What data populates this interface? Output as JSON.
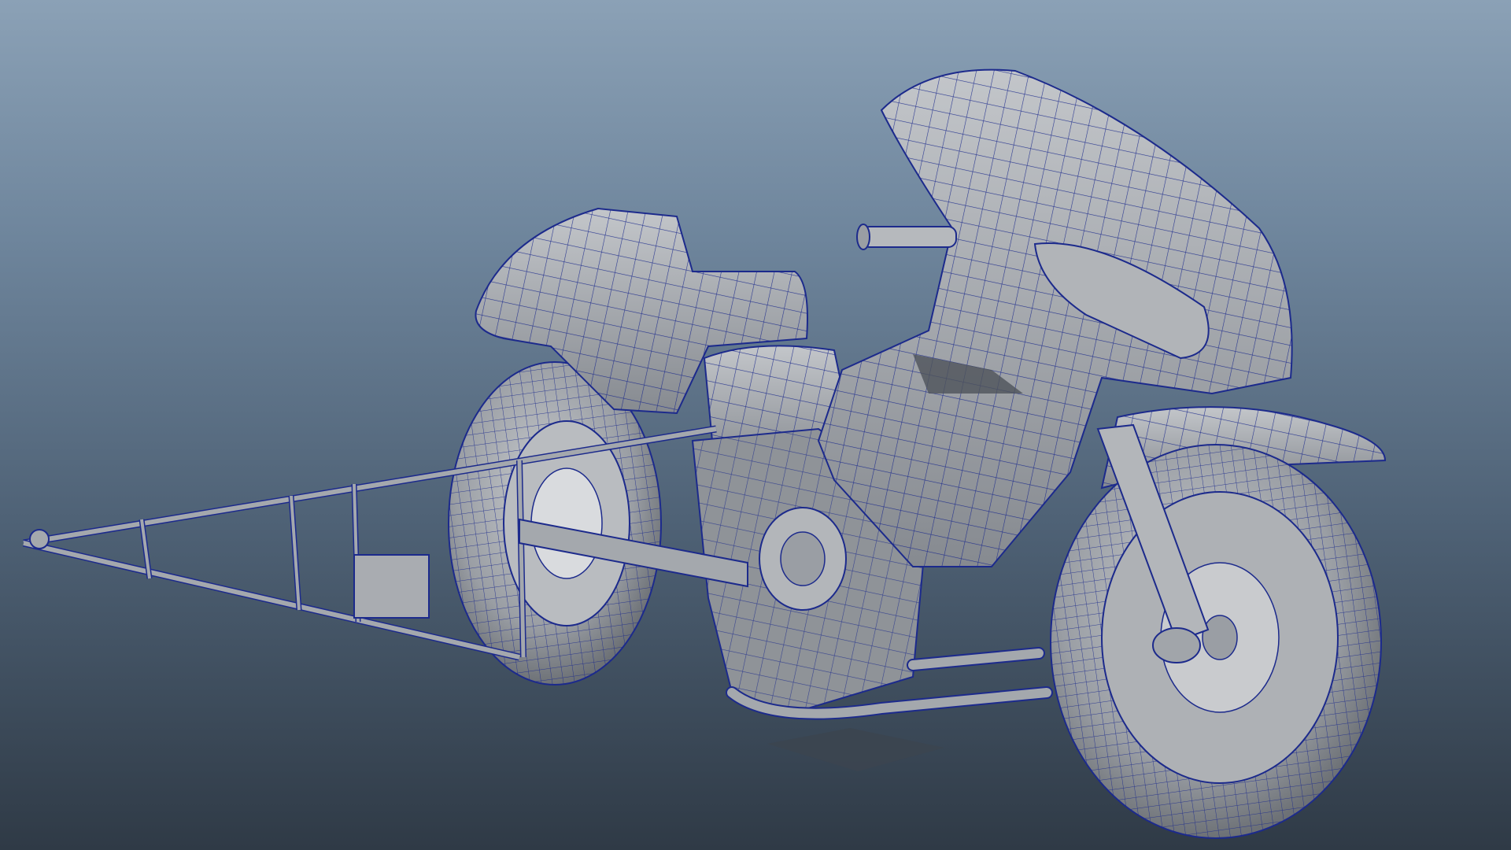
{
  "viewport": {
    "background_top": "#8ba1b6",
    "background_bottom": "#2f3a46",
    "shading_mode": "wireframe-on-shaded"
  },
  "model": {
    "subject": "drag-racing-motorcycle-with-wheelie-bar",
    "surface_color": "#9a9ea4",
    "surface_light": "#c3c6ca",
    "surface_dark": "#6d7176",
    "wire_color": "#1c2a8c"
  }
}
